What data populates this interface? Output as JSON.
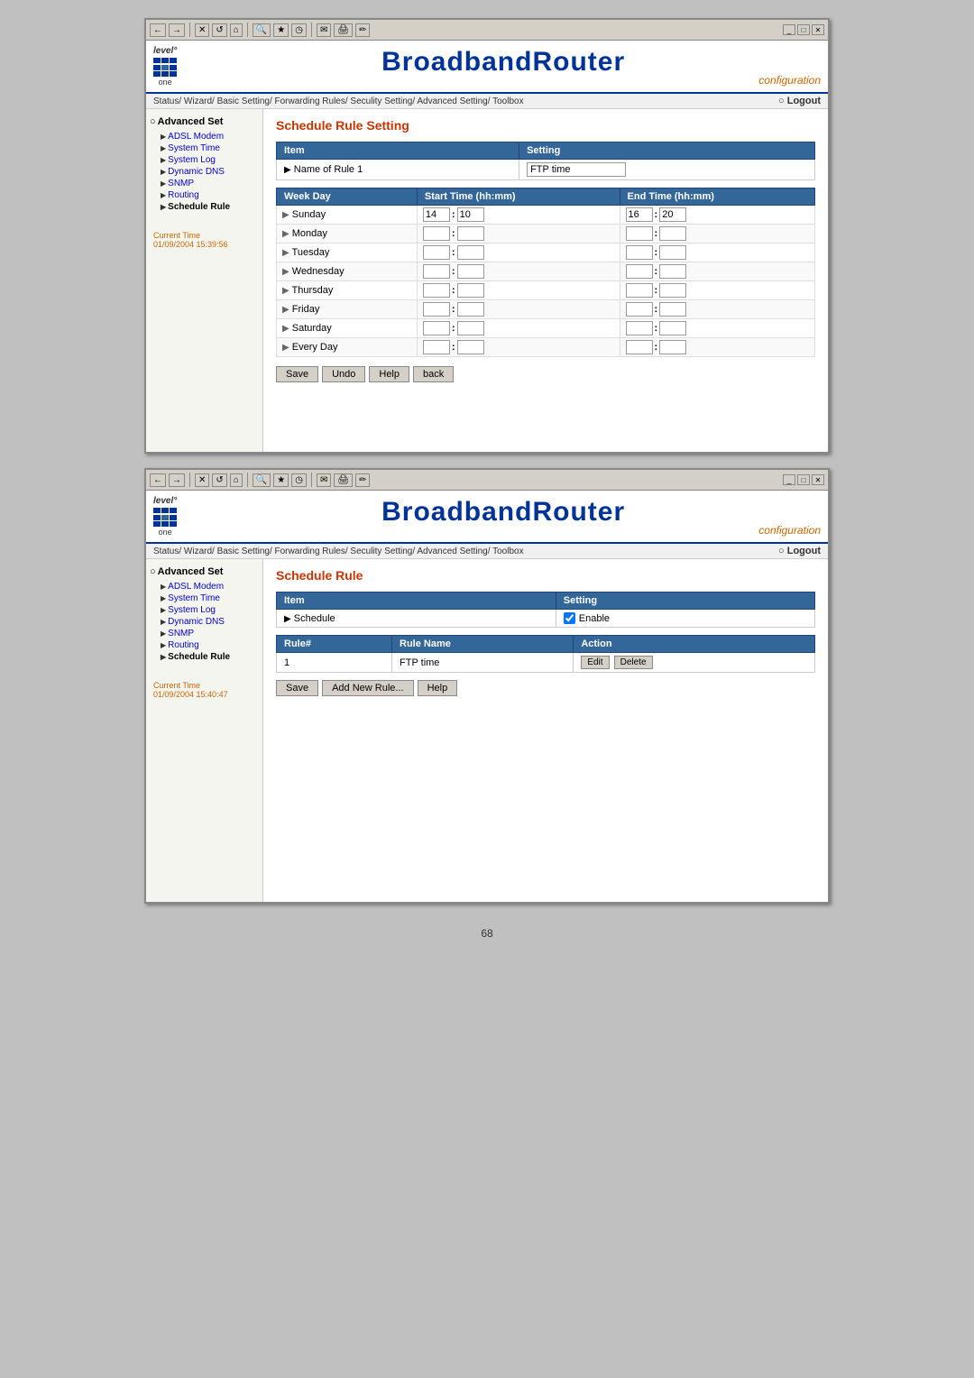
{
  "page": {
    "page_number": "68"
  },
  "window1": {
    "title": "BroadbandRouter Configuration",
    "toolbar": {
      "back": "←",
      "forward": "→",
      "stop": "✕",
      "refresh": "↺",
      "home": "⌂",
      "search": "🔍",
      "favorites": "★",
      "history": "◷",
      "mail": "✉",
      "print": "🖨",
      "edit": "✏"
    },
    "win_controls": {
      "minimize": "_",
      "restore": "□",
      "close": "✕"
    }
  },
  "router": {
    "brand": "level°",
    "brand_sub": "one",
    "title": "BroadbandRouter",
    "subtitle": "configuration",
    "nav_links": "Status/ Wizard/ Basic Setting/ Forwarding Rules/ Seculity Setting/ Advanced Setting/ Toolbox",
    "logout": "Logout"
  },
  "panel1": {
    "section_header": "Advanced Set",
    "sidebar_items": [
      {
        "label": "ADSL Modem",
        "indent": true
      },
      {
        "label": "System Time",
        "indent": true
      },
      {
        "label": "System Log",
        "indent": true
      },
      {
        "label": "Dynamic DNS",
        "indent": true
      },
      {
        "label": "SNMP",
        "indent": true
      },
      {
        "label": "Routing",
        "indent": true,
        "active": false
      },
      {
        "label": "Schedule Rule",
        "indent": true,
        "active": true
      }
    ],
    "current_time_label": "Current Time",
    "current_time_value": "01/09/2004 15:39:56",
    "main": {
      "title": "Schedule Rule Setting",
      "setting_table": {
        "headers": [
          "Item",
          "Setting"
        ],
        "row": {
          "item": "Name of Rule 1",
          "value": "FTP time"
        }
      },
      "schedule_table": {
        "headers": [
          "Week Day",
          "Start Time (hh:mm)",
          "End Time (hh:mm)"
        ],
        "rows": [
          {
            "day": "Sunday",
            "start_h": "14",
            "start_m": "10",
            "end_h": "16",
            "end_m": "20"
          },
          {
            "day": "Monday",
            "start_h": "",
            "start_m": "",
            "end_h": "",
            "end_m": ""
          },
          {
            "day": "Tuesday",
            "start_h": "",
            "start_m": "",
            "end_h": "",
            "end_m": ""
          },
          {
            "day": "Wednesday",
            "start_h": "",
            "start_m": "",
            "end_h": "",
            "end_m": ""
          },
          {
            "day": "Thursday",
            "start_h": "",
            "start_m": "",
            "end_h": "",
            "end_m": ""
          },
          {
            "day": "Friday",
            "start_h": "",
            "start_m": "",
            "end_h": "",
            "end_m": ""
          },
          {
            "day": "Saturday",
            "start_h": "",
            "start_m": "",
            "end_h": "",
            "end_m": ""
          },
          {
            "day": "Every Day",
            "start_h": "",
            "start_m": "",
            "end_h": "",
            "end_m": ""
          }
        ]
      },
      "buttons": {
        "save": "Save",
        "undo": "Undo",
        "help": "Help",
        "back": "back"
      }
    }
  },
  "panel2": {
    "section_header": "Advanced Set",
    "sidebar_items": [
      {
        "label": "ADSL Modem",
        "indent": true
      },
      {
        "label": "System Time",
        "indent": true
      },
      {
        "label": "System Log",
        "indent": true
      },
      {
        "label": "Dynamic DNS",
        "indent": true
      },
      {
        "label": "SNMP",
        "indent": true
      },
      {
        "label": "Routing",
        "indent": true,
        "active": false
      },
      {
        "label": "Schedule Rule",
        "indent": true,
        "active": true
      }
    ],
    "current_time_label": "Current Time",
    "current_time_value": "01/09/2004 15:40:47",
    "main": {
      "title": "Schedule Rule",
      "setting_table": {
        "headers": [
          "Item",
          "Setting"
        ],
        "row": {
          "item": "Schedule",
          "checkbox_label": "Enable",
          "checked": true
        }
      },
      "rule_table": {
        "headers": [
          "Rule#",
          "Rule Name",
          "Action"
        ],
        "rows": [
          {
            "rule_num": "1",
            "rule_name": "FTP time",
            "edit": "Edit",
            "delete": "Delete"
          }
        ]
      },
      "buttons": {
        "save": "Save",
        "add_new_rule": "Add New Rule...",
        "help": "Help"
      }
    }
  }
}
